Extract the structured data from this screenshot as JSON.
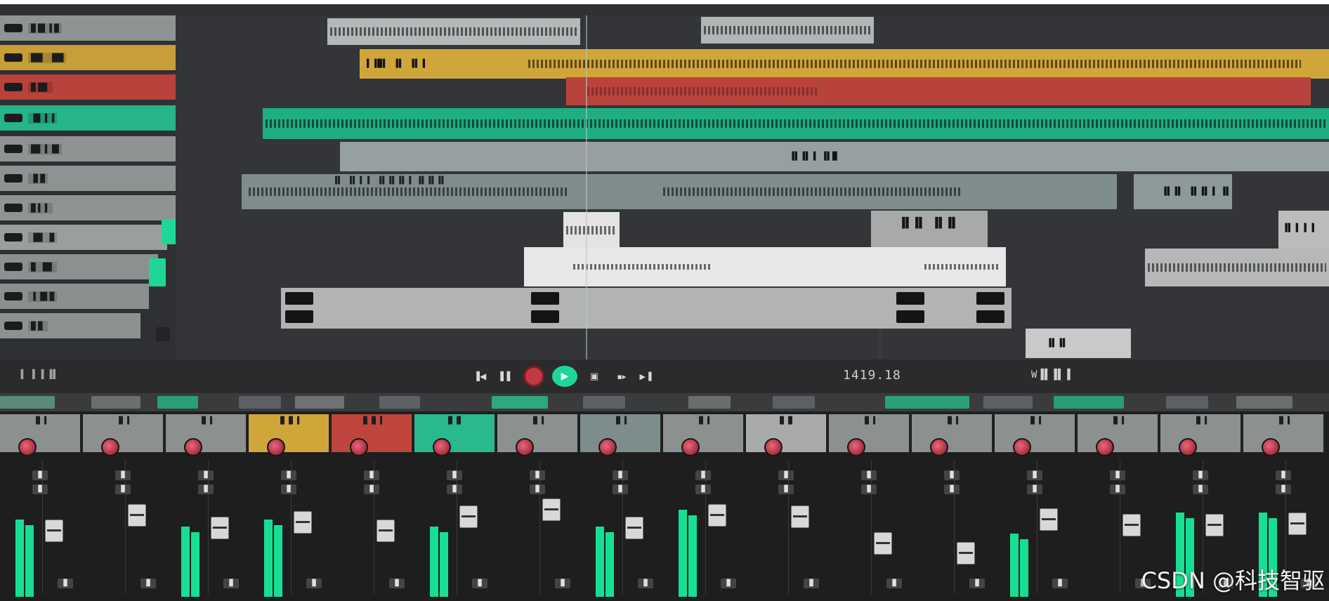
{
  "app": {
    "title": ""
  },
  "colors": {
    "accent_green": "#1ed796",
    "track_yellow": "#d0a63a",
    "track_red": "#c0453c",
    "track_teal": "#28b98e",
    "background": "#2f3033",
    "mixer_bg": "#1e1e1f",
    "knob_red": "#b23549"
  },
  "tracks": [
    {
      "label": "█▐█ ▌█"
    },
    {
      "label": "██▌ ▐██"
    },
    {
      "label": "█▐█▌"
    },
    {
      "label": "▐█ ▌▐"
    },
    {
      "label": "██ ▌▐█"
    },
    {
      "label": "▐▌█"
    },
    {
      "label": "█▐ ▌"
    },
    {
      "label": "▐█▌ █"
    },
    {
      "label": "█ ▐█▌"
    },
    {
      "label": "▐ █▌█"
    },
    {
      "label": "█▐▌"
    }
  ],
  "clips": [
    {
      "label": "▌▐█▌ ▐▌ ▐▌▐"
    },
    {
      "label": "▐▌▐▌▐ ▐▌█"
    },
    {
      "label": "▐▌ ▐▌▐ ▌ ▐▌▐▌▐▌▐ ▐▌▐▌▐▌"
    },
    {
      "label": "▐▌▐▌ ▐▌▐▌▐ ▐▌▐"
    },
    {
      "label": "▐▌▐▌ ▐▌▐▌"
    },
    {
      "label": "▐▌▐ ▌▐"
    },
    {
      "label": "▐▌▐▌"
    },
    {
      "label": "▐▌▐▌▐▌▐"
    }
  ],
  "transport": {
    "left_label": "▐ ▐ ▌▐▌",
    "time_display": "1419.18",
    "right_label": "W▐▌▐▌▐"
  },
  "mixer": {
    "channels": [
      {
        "label": "▐▌▐",
        "color": "#8c9190"
      },
      {
        "label": "▐▌▐",
        "color": "#8c9190"
      },
      {
        "label": "▐▌▐",
        "color": "#8c9190"
      },
      {
        "label": "▐▌▐▌▐",
        "color": "#d0a63a"
      },
      {
        "label": "▐▌▐▌▐",
        "color": "#c0453c"
      },
      {
        "label": "▐▌▐▌",
        "color": "#28b98e"
      },
      {
        "label": "▐▌▐",
        "color": "#8c9190"
      },
      {
        "label": "▐▌▐",
        "color": "#7d8d8c"
      },
      {
        "label": "▐▌▐",
        "color": "#8c9190"
      },
      {
        "label": "▐▌▐▌",
        "color": "#a9abab"
      },
      {
        "label": "▐▌▐",
        "color": "#8c9190"
      },
      {
        "label": "▐▌▐",
        "color": "#8c9190"
      },
      {
        "label": "▐▌▐",
        "color": "#8c9190"
      },
      {
        "label": "▐▌▐",
        "color": "#8c9190"
      },
      {
        "label": "▐▌▐",
        "color": "#8c9190"
      },
      {
        "label": "▐▌▐",
        "color": "#8c9190"
      }
    ],
    "button_label": "▐▌"
  },
  "watermark": "CSDN @科技智驱"
}
